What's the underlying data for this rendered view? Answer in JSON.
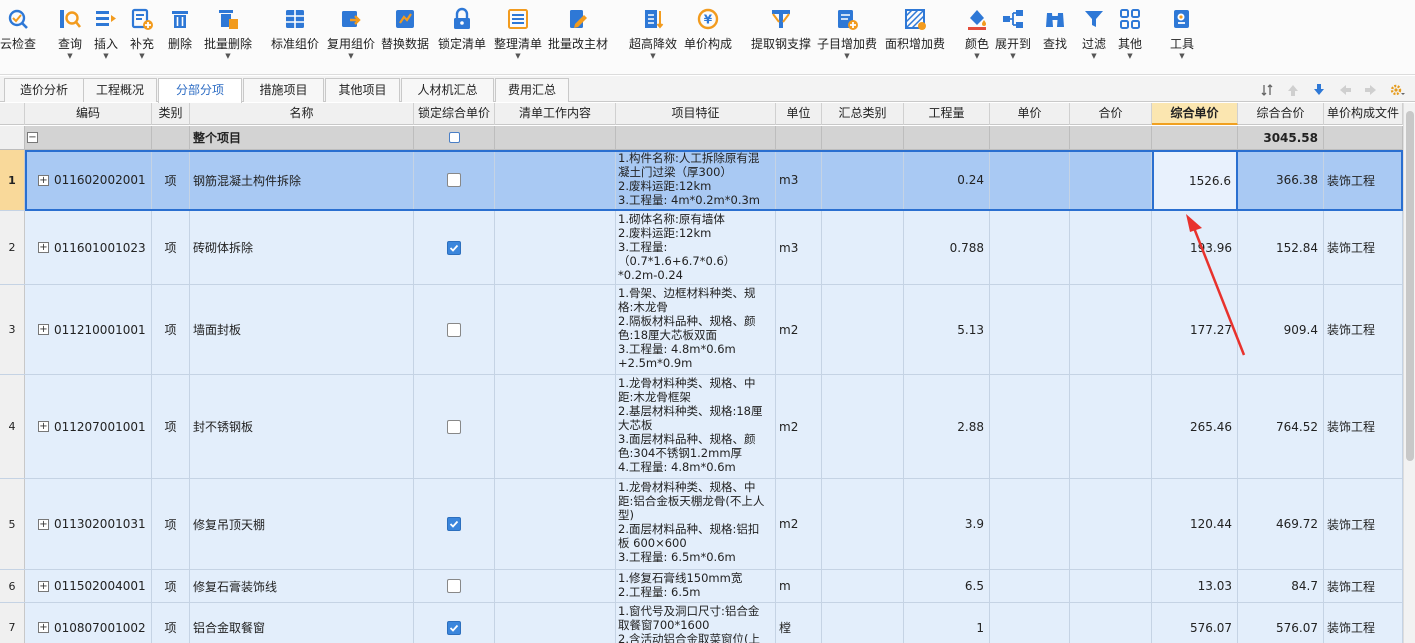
{
  "colors": {
    "accent": "#2a6fd0",
    "row_bg": "#e3eefb",
    "selected_row": "#a9c9f3",
    "sel_header": "#fbe6b0",
    "annotation_arrow": "#e8322d"
  },
  "toolbar": {
    "buttons": [
      {
        "label": "云检查",
        "icon": "cloud-check-icon",
        "dropdown": false
      },
      {
        "label": "查询",
        "icon": "search-icon",
        "dropdown": true
      },
      {
        "label": "插入",
        "icon": "insert-icon",
        "dropdown": true
      },
      {
        "label": "补充",
        "icon": "supplement-icon",
        "dropdown": true
      },
      {
        "label": "删除",
        "icon": "trash-icon",
        "dropdown": false
      },
      {
        "label": "批量删除",
        "icon": "batch-delete-icon",
        "dropdown": true
      },
      {
        "label": "标准组价",
        "icon": "standard-price-icon",
        "dropdown": false
      },
      {
        "label": "复用组价",
        "icon": "reuse-price-icon",
        "dropdown": true
      },
      {
        "label": "替换数据",
        "icon": "replace-data-icon",
        "dropdown": false
      },
      {
        "label": "锁定清单",
        "icon": "lock-icon",
        "dropdown": false
      },
      {
        "label": "整理清单",
        "icon": "organize-list-icon",
        "dropdown": true
      },
      {
        "label": "批量改主材",
        "icon": "batch-edit-icon",
        "dropdown": false
      },
      {
        "label": "超高降效",
        "icon": "height-reduce-icon",
        "dropdown": true
      },
      {
        "label": "单价构成",
        "icon": "unit-price-icon",
        "dropdown": false
      },
      {
        "label": "提取钢支撑",
        "icon": "steel-support-icon",
        "dropdown": false
      },
      {
        "label": "子目增加费",
        "icon": "sub-item-fee-icon",
        "dropdown": true
      },
      {
        "label": "面积增加费",
        "icon": "area-fee-icon",
        "dropdown": false
      },
      {
        "label": "颜色",
        "icon": "color-fill-icon",
        "dropdown": true
      },
      {
        "label": "展开到",
        "icon": "expand-tree-icon",
        "dropdown": true
      },
      {
        "label": "查找",
        "icon": "binoculars-icon",
        "dropdown": false
      },
      {
        "label": "过滤",
        "icon": "filter-icon",
        "dropdown": true
      },
      {
        "label": "其他",
        "icon": "grid-icon",
        "dropdown": true
      },
      {
        "label": "工具",
        "icon": "tools-icon",
        "dropdown": true
      }
    ]
  },
  "tabs": [
    {
      "label": "造价分析"
    },
    {
      "label": "工程概况"
    },
    {
      "label": "分部分项",
      "active": true
    },
    {
      "label": "措施项目"
    },
    {
      "label": "其他项目"
    },
    {
      "label": "人材机汇总"
    },
    {
      "label": "费用汇总"
    }
  ],
  "columns": [
    "编码",
    "类别",
    "名称",
    "锁定综合单价",
    "清单工作内容",
    "项目特征",
    "单位",
    "汇总类别",
    "工程量",
    "单价",
    "合价",
    "综合单价",
    "综合合价",
    "单价构成文件"
  ],
  "root_row": {
    "name": "整个项目",
    "total": "3045.58"
  },
  "rows": [
    {
      "num": "1",
      "code": "011602002001",
      "type": "项",
      "name": "钢筋混凝土构件拆除",
      "locked": false,
      "feature": "1.构件名称:人工拆除原有混\n凝土门过梁（厚300）\n2.废料运距:12km\n3.工程量: 4m*0.2m*0.3m",
      "unit": "m3",
      "qty": "0.24",
      "comp_price": "1526.6",
      "comp_total": "366.38",
      "file": "装饰工程"
    },
    {
      "num": "2",
      "code": "011601001023",
      "type": "项",
      "name": "砖砌体拆除",
      "locked": true,
      "feature": "1.砌体名称:原有墙体\n2.废料运距:12km\n3.工程量:\n（0.7*1.6+6.7*0.6）\n*0.2m-0.24",
      "unit": "m3",
      "qty": "0.788",
      "comp_price": "193.96",
      "comp_total": "152.84",
      "file": "装饰工程"
    },
    {
      "num": "3",
      "code": "011210001001",
      "type": "项",
      "name": "墙面封板",
      "locked": false,
      "feature": "1.骨架、边框材料种类、规\n格:木龙骨\n2.隔板材料品种、规格、颜\n色:18厘大芯板双面\n3.工程量: 4.8m*0.6m\n+2.5m*0.9m",
      "unit": "m2",
      "qty": "5.13",
      "comp_price": "177.27",
      "comp_total": "909.4",
      "file": "装饰工程"
    },
    {
      "num": "4",
      "code": "011207001001",
      "type": "项",
      "name": "封不锈钢板",
      "locked": false,
      "feature": "1.龙骨材料种类、规格、中\n距:木龙骨框架\n2.基层材料种类、规格:18厘\n大芯板\n3.面层材料品种、规格、颜\n色:304不锈钢1.2mm厚\n4.工程量: 4.8m*0.6m",
      "unit": "m2",
      "qty": "2.88",
      "comp_price": "265.46",
      "comp_total": "764.52",
      "file": "装饰工程"
    },
    {
      "num": "5",
      "code": "011302001031",
      "type": "项",
      "name": "修复吊顶天棚",
      "locked": true,
      "feature": "1.龙骨材料种类、规格、中\n距:铝合金板天棚龙骨(不上人\n型)\n2.面层材料品种、规格:铝扣\n板 600×600\n3.工程量: 6.5m*0.6m",
      "unit": "m2",
      "qty": "3.9",
      "comp_price": "120.44",
      "comp_total": "469.72",
      "file": "装饰工程"
    },
    {
      "num": "6",
      "code": "011502004001",
      "type": "项",
      "name": "修复石膏装饰线",
      "locked": false,
      "feature": "1.修复石膏线150mm宽\n2.工程量: 6.5m",
      "unit": "m",
      "qty": "6.5",
      "comp_price": "13.03",
      "comp_total": "84.7",
      "file": "装饰工程"
    },
    {
      "num": "7",
      "code": "010807001002",
      "type": "项",
      "name": "铝合金取餐窗",
      "locked": true,
      "feature": "1.窗代号及洞口尺寸:铝合金\n取餐窗700*1600\n2.含活动铝合金取菜窗位(上",
      "unit": "樘",
      "qty": "1",
      "comp_price": "576.07",
      "comp_total": "576.07",
      "file": "装饰工程"
    }
  ]
}
